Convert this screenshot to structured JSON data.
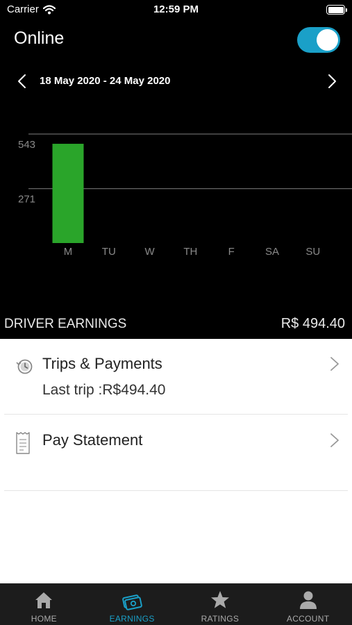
{
  "status_bar": {
    "carrier": "Carrier",
    "time": "12:59 PM"
  },
  "header": {
    "title": "Online",
    "toggle_on": true
  },
  "date_nav": {
    "range": "18 May 2020 - 24 May 2020"
  },
  "chart_data": {
    "type": "bar",
    "categories": [
      "M",
      "TU",
      "W",
      "TH",
      "F",
      "SA",
      "SU"
    ],
    "values": [
      494.4,
      0,
      0,
      0,
      0,
      0,
      0
    ],
    "yticks": [
      271,
      543
    ],
    "ylim": [
      0,
      543
    ],
    "grid": true,
    "colors": {
      "bar": "#2aa52a",
      "grid": "#666666",
      "tick": "#8a8a8a"
    }
  },
  "earnings": {
    "label": "DRIVER EARNINGS",
    "value": "R$ 494.40"
  },
  "list": {
    "trips": {
      "title": "Trips & Payments",
      "subtitle": "Last trip :R$494.40",
      "icon": "history-icon"
    },
    "pay": {
      "title": "Pay Statement",
      "icon": "receipt-icon"
    }
  },
  "tabs": [
    {
      "label": "HOME",
      "icon": "home-icon",
      "active": false
    },
    {
      "label": "EARNINGS",
      "icon": "money-icon",
      "active": true
    },
    {
      "label": "RATINGS",
      "icon": "star-icon",
      "active": false
    },
    {
      "label": "ACCOUNT",
      "icon": "person-icon",
      "active": false
    }
  ],
  "colors": {
    "accent": "#1aa0c8",
    "bar": "#2aa52a",
    "background": "#000000"
  }
}
